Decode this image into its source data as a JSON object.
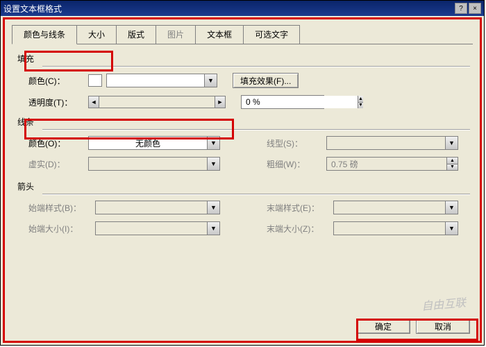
{
  "window": {
    "title": "设置文本框格式"
  },
  "tabs": {
    "colors_lines": "颜色与线条",
    "size": "大小",
    "layout": "版式",
    "picture": "图片",
    "textbox": "文本框",
    "alt_text": "可选文字"
  },
  "groups": {
    "fill": "填充",
    "line": "线条",
    "arrows": "箭头"
  },
  "fill": {
    "color_label": "颜色(C)：",
    "effects_button": "填充效果(F)...",
    "transparency_label": "透明度(T)：",
    "transparency_value": "0 %"
  },
  "line": {
    "color_label": "颜色(O)：",
    "color_value": "无颜色",
    "dash_label": "虚实(D)：",
    "style_label": "线型(S)：",
    "weight_label": "粗细(W)：",
    "weight_value": "0.75 磅"
  },
  "arrows": {
    "begin_style_label": "始端样式(B)：",
    "end_style_label": "末端样式(E)：",
    "begin_size_label": "始端大小(I)：",
    "end_size_label": "末端大小(Z)："
  },
  "footer": {
    "ok": "确定",
    "cancel": "取消"
  },
  "watermark": "自由互联"
}
